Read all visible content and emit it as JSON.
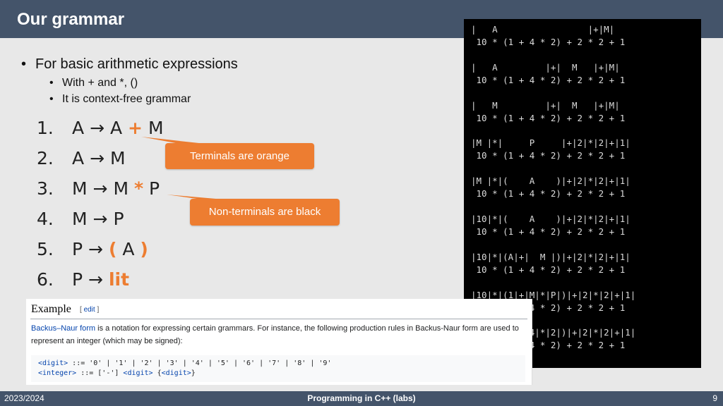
{
  "slide": {
    "title": "Our grammar",
    "bullets": {
      "main": "For basic arithmetic expressions",
      "sub1": "With + and *, ()",
      "sub2": "It is context-free grammar"
    },
    "rules": [
      {
        "num": "1.",
        "lhs": "A",
        "arrow": "→",
        "parts": [
          "A",
          "+",
          "M"
        ]
      },
      {
        "num": "2.",
        "lhs": "A",
        "arrow": "→",
        "parts": [
          "M"
        ]
      },
      {
        "num": "3.",
        "lhs": "M",
        "arrow": "→",
        "parts": [
          "M",
          "*",
          "P"
        ]
      },
      {
        "num": "4.",
        "lhs": "M",
        "arrow": "→",
        "parts": [
          "P"
        ]
      },
      {
        "num": "5.",
        "lhs": "P",
        "arrow": "→",
        "parts": [
          "(",
          "A",
          ")"
        ]
      },
      {
        "num": "6.",
        "lhs": "P",
        "arrow": "→",
        "parts": [
          "lit"
        ]
      }
    ],
    "callouts": {
      "terminals": "Terminals are orange",
      "nonterminals": "Non-terminals are black"
    },
    "accent_color": "#ed7d31",
    "header_color": "#44546a"
  },
  "terminal": {
    "lines": [
      "|   A                 |+|M|",
      " 10 * (1 + 4 * 2) + 2 * 2 + 1",
      "|   A         |+|  M   |+|M|",
      " 10 * (1 + 4 * 2) + 2 * 2 + 1",
      "|   M         |+|  M   |+|M|",
      " 10 * (1 + 4 * 2) + 2 * 2 + 1",
      "|M |*|     P     |+|2|*|2|+|1|",
      " 10 * (1 + 4 * 2) + 2 * 2 + 1",
      "|M |*|(    A    )|+|2|*|2|+|1|",
      " 10 * (1 + 4 * 2) + 2 * 2 + 1",
      "|10|*|(    A    )|+|2|*|2|+|1|",
      " 10 * (1 + 4 * 2) + 2 * 2 + 1",
      "|10|*|(A|+|  M |)|+|2|*|2|+|1|",
      " 10 * (1 + 4 * 2) + 2 * 2 + 1",
      "|10|*|(1|+|M|*|P|)|+|2|*|2|+|1|",
      " 10 * (1 + 4 * 2) + 2 * 2 + 1",
      "|10|*|(1|+|4|*|2|)|+|2|*|2|+|1|",
      " 10 * (1 + 4 * 2) + 2 * 2 + 1"
    ]
  },
  "wiki": {
    "title": "Example",
    "edit_open": "[ ",
    "edit_link": "edit",
    "edit_close": " ]",
    "para_link": "Backus–Naur form",
    "para_text": " is a notation for expressing certain grammars. For instance, the following production rules in Backus-Naur form are used to represent an integer (which may be signed):",
    "code": {
      "digit_nt": "<digit>",
      "digit_rest": " ::= '0' | '1' | '2' | '3' | '4' | '5' | '6' | '7' | '8' | '9'",
      "integer_nt": "<integer>",
      "integer_mid": " ::= ['-'] ",
      "integer_digit": "<digit>",
      "integer_tail_open": " {",
      "integer_tail_digit": "<digit>",
      "integer_tail_close": "}"
    }
  },
  "footer": {
    "left": "2023/2024",
    "center": "Programming in C++ (labs)",
    "right": "9"
  }
}
